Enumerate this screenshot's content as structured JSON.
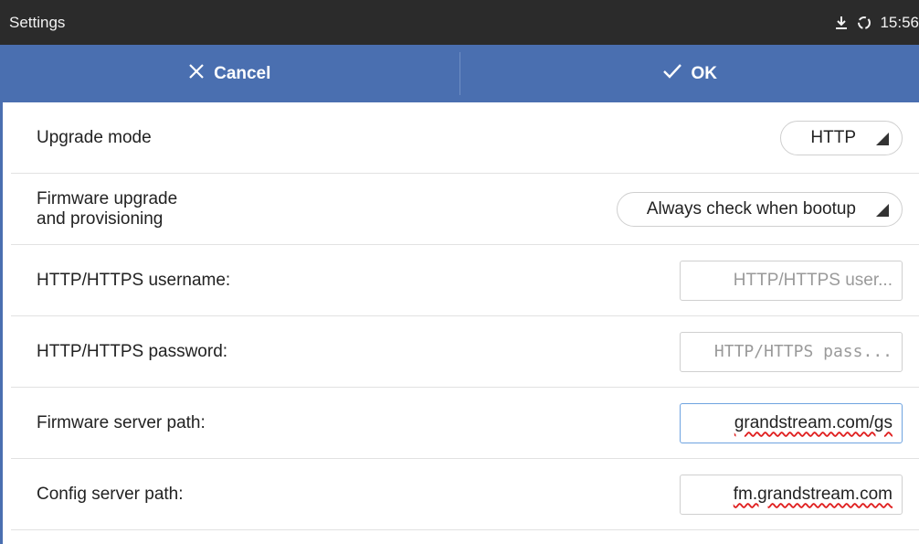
{
  "status_bar": {
    "title": "Settings",
    "time": "15:56",
    "icons": [
      "download-icon",
      "sync-icon"
    ]
  },
  "action_bar": {
    "cancel_label": "Cancel",
    "ok_label": "OK",
    "cancel_icon": "close-icon",
    "ok_icon": "check-icon"
  },
  "rows": {
    "upgrade_mode": {
      "label": "Upgrade mode",
      "value": "HTTP"
    },
    "firmware_upgrade": {
      "label_line1": "Firmware upgrade",
      "label_line2": "and provisioning",
      "value": "Always check when bootup"
    },
    "http_username": {
      "label": "HTTP/HTTPS username:",
      "placeholder": "HTTP/HTTPS user...",
      "value": ""
    },
    "http_password": {
      "label": "HTTP/HTTPS password:",
      "placeholder": "HTTP/HTTPS pass...",
      "value": ""
    },
    "firmware_server": {
      "label": "Firmware server path:",
      "value": "grandstream.com/gs"
    },
    "config_server": {
      "label": "Config server path:",
      "value": "fm.grandstream.com"
    }
  },
  "colors": {
    "action_bar": "#4a6fb0",
    "status_bar": "#2b2b2b"
  }
}
